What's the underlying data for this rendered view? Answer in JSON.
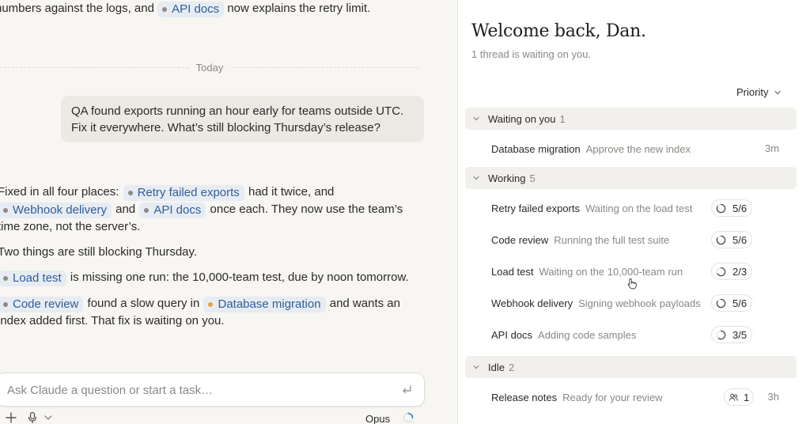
{
  "chat": {
    "intro": {
      "before": "numbers against the logs, and",
      "chip": "API docs",
      "after": "now explains the retry limit."
    },
    "divider_label": "Today",
    "user_message": {
      "line1": "QA found exports running an hour early for teams outside UTC.",
      "line2": "Fix it everywhere. What’s still blocking Thursday’s release?"
    },
    "reply": {
      "p1": {
        "t1": "Fixed in all four places:",
        "chip1": "Retry failed exports",
        "t2": "had it twice, and",
        "chip2": "Webhook delivery",
        "t3": "and",
        "chip3": "API docs",
        "t4": "once each. They now use the team’s",
        "t5": "time zone, not the server’s."
      },
      "p2": "Two things are still blocking Thursday.",
      "p3": {
        "chip": "Load test",
        "text": "is missing one run: the 10,000-team test, due by noon tomorrow."
      },
      "p4": {
        "chip1": "Code review",
        "t1": "found a slow query in",
        "chip2": "Database migration",
        "t2": "and wants an",
        "t3": "index added first. That fix is waiting on you."
      }
    },
    "composer": {
      "placeholder": "Ask Claude a question or start a task…",
      "model": "Opus"
    },
    "icons": {
      "enter": "enter-icon",
      "plus": "plus-icon",
      "mic": "microphone-icon",
      "chevron": "chevron-down-icon",
      "spinner": "spinner-icon"
    }
  },
  "panel": {
    "welcome": "Welcome back, Dan.",
    "subtitle": "1 thread is waiting on you.",
    "sort_label": "Priority",
    "sections": [
      {
        "title": "Waiting on you",
        "count": "1",
        "rows": [
          {
            "name": "Database migration",
            "desc": "Approve the new index",
            "time": "3m"
          }
        ]
      },
      {
        "title": "Working",
        "count": "5",
        "rows": [
          {
            "name": "Retry failed exports",
            "desc": "Waiting on the load test",
            "progress": "5/6",
            "fraction": 0.83
          },
          {
            "name": "Code review",
            "desc": "Running the full test suite",
            "progress": "5/6",
            "fraction": 0.83
          },
          {
            "name": "Load test",
            "desc": "Waiting on the 10,000-team run",
            "progress": "2/3",
            "fraction": 0.67
          },
          {
            "name": "Webhook delivery",
            "desc": "Signing webhook payloads",
            "progress": "5/6",
            "fraction": 0.83
          },
          {
            "name": "API docs",
            "desc": "Adding code samples",
            "progress": "3/5",
            "fraction": 0.6
          }
        ]
      },
      {
        "title": "Idle",
        "count": "2",
        "rows": [
          {
            "name": "Release notes",
            "desc": "Ready for your review",
            "comments": "1",
            "time": "3h"
          }
        ]
      }
    ],
    "colors": {
      "chip_bg": "#e7ecf3",
      "chip_text": "#2e5f99",
      "amber_dot": "#e9a23b"
    }
  }
}
